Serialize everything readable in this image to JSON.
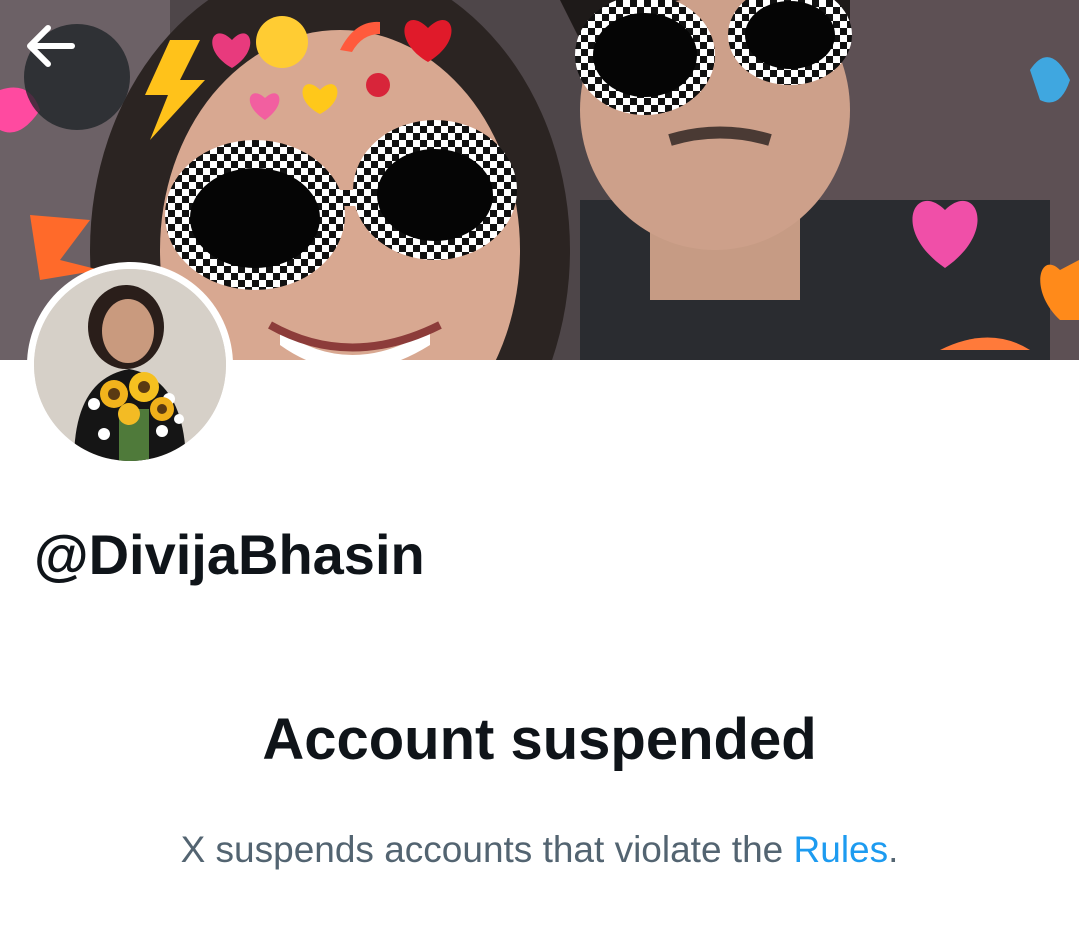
{
  "header": {
    "back_button_label": "Back",
    "banner_alt": "Profile banner photo"
  },
  "profile": {
    "avatar_alt": "Profile photo",
    "handle": "@DivijaBhasin"
  },
  "suspension": {
    "title": "Account suspended",
    "message_prefix": "X suspends accounts that violate the ",
    "rules_link": "Rules",
    "message_suffix": "."
  },
  "colors": {
    "text_primary": "#0f1419",
    "text_secondary": "#536471",
    "link": "#1d9bf0",
    "back_button_bg": "#1e2428"
  },
  "icons": {
    "back": "arrow-left-icon"
  }
}
